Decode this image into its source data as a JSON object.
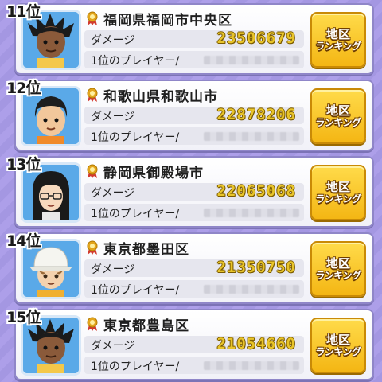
{
  "colors": {
    "background": "#a99ce6",
    "panel_border": "#8f86c8",
    "damage_value": "#e8c42a",
    "button_yellow": "#f4b614"
  },
  "common": {
    "damage_label": "ダメージ",
    "player_label": "1位のプレイヤー/",
    "button_line1": "地区",
    "button_line2": "ランキング",
    "medal_icon": "medal-icon"
  },
  "rows": [
    {
      "rank": "11位",
      "region": "福岡県福岡市中央区",
      "damage": "23506679",
      "avatar": "dark-skin-spiky-hair"
    },
    {
      "rank": "12位",
      "region": "和歌山県和歌山市",
      "damage": "22878206",
      "avatar": "short-black-hair-boy"
    },
    {
      "rank": "13位",
      "region": "静岡県御殿場市",
      "damage": "22065068",
      "avatar": "long-hair-glasses-girl"
    },
    {
      "rank": "14位",
      "region": "東京都墨田区",
      "damage": "21350750",
      "avatar": "white-hat-boy"
    },
    {
      "rank": "15位",
      "region": "東京都豊島区",
      "damage": "21054660",
      "avatar": "dark-skin-spiky-hair"
    }
  ]
}
